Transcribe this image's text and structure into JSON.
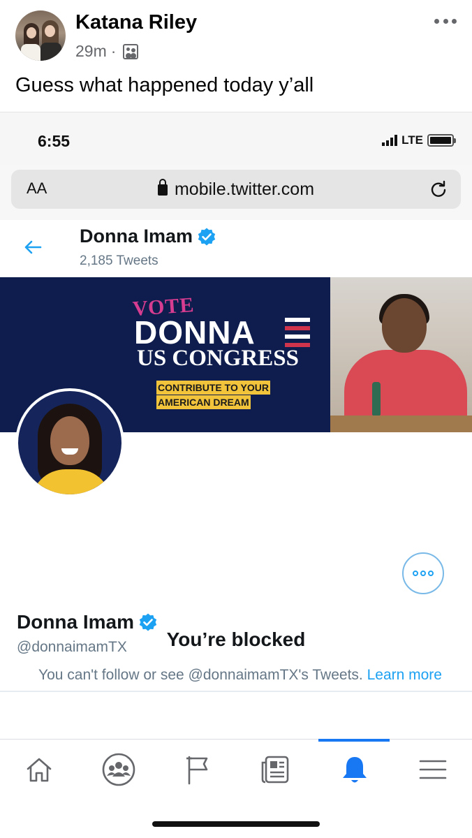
{
  "post": {
    "author": "Katana Riley",
    "time": "29m",
    "separator": "·",
    "audience_icon": "friends-icon",
    "text": "Guess what happened today y’all"
  },
  "ios": {
    "time": "6:55",
    "network": "LTE",
    "url_text_size": "AA",
    "url": "mobile.twitter.com"
  },
  "twitter": {
    "header_name": "Donna Imam",
    "tweet_count": "2,185 Tweets",
    "banner": {
      "vote": "VOTE",
      "donna": "DONNA",
      "us_congress": "US CONGRESS",
      "contribute_line1": "CONTRIBUTE TO YOUR",
      "contribute_line2": "AMERICAN DREAM"
    },
    "name": "Donna Imam",
    "handle": "@donnaimamTX",
    "blocked_title": "You’re blocked",
    "blocked_message": "You can't follow or see @donnaimamTX's Tweets.",
    "learn_more": "Learn more"
  },
  "fb_nav": {
    "items": [
      "home-icon",
      "groups-icon",
      "pages-flag-icon",
      "news-icon",
      "notifications-bell-icon",
      "menu-icon"
    ],
    "active": "notifications-bell-icon",
    "colors": {
      "active": "#1877f2",
      "inactive": "#65676b"
    }
  }
}
